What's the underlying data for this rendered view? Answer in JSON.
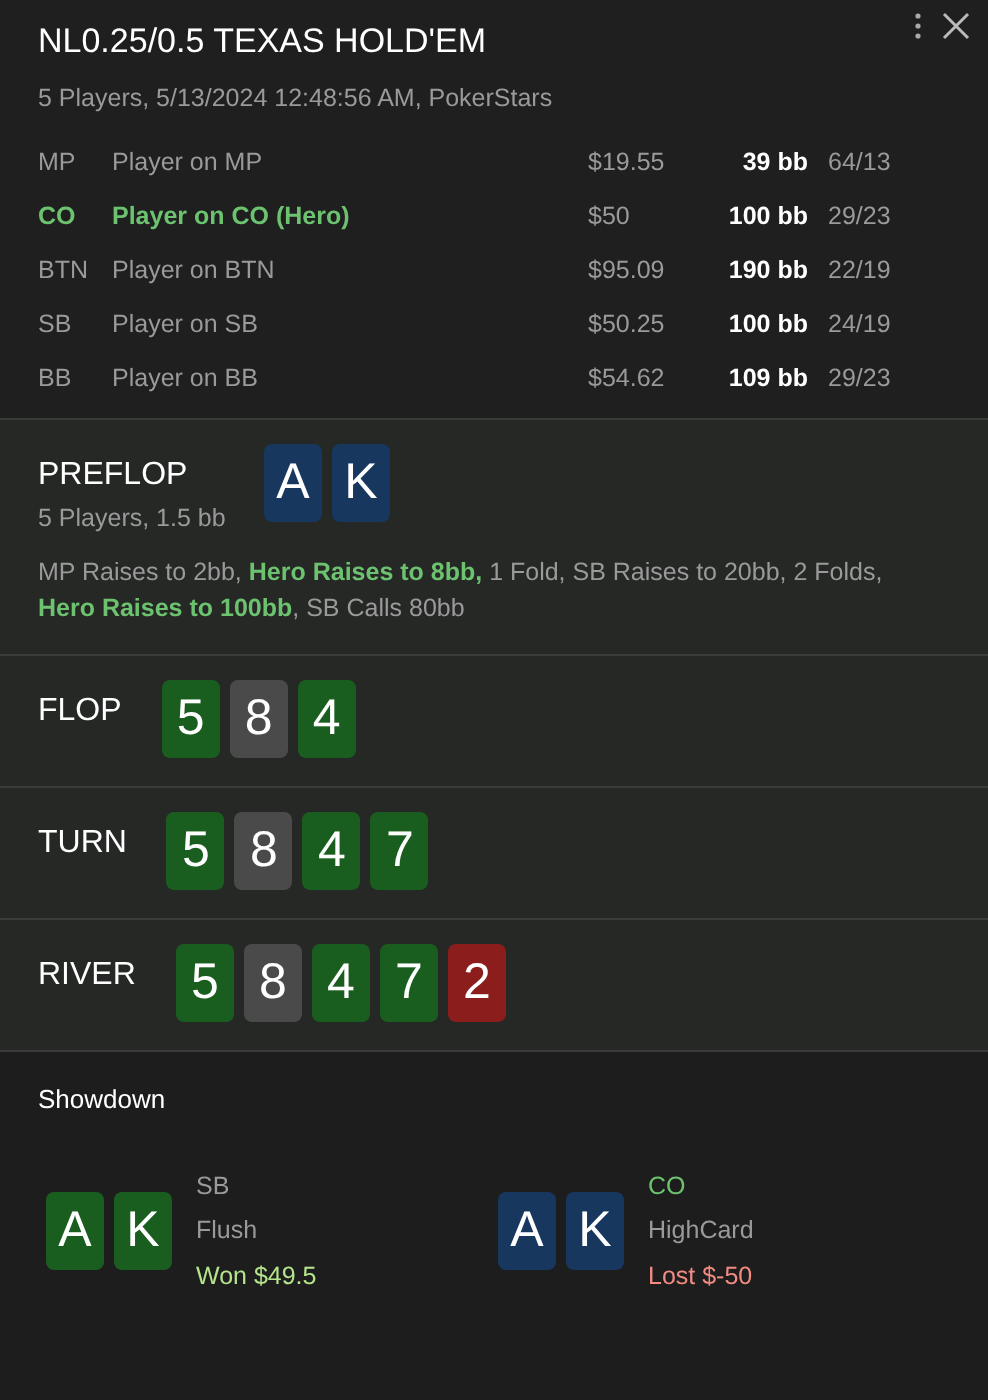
{
  "header": {
    "title": "NL0.25/0.5 TEXAS HOLD'EM",
    "subtitle": "5 Players, 5/13/2024 12:48:56 AM, PokerStars"
  },
  "players": [
    {
      "position": "MP",
      "name": "Player on MP",
      "stack": "$19.55",
      "bb": "39 bb",
      "stats": "64/13",
      "hero": false
    },
    {
      "position": "CO",
      "name": "Player on CO (Hero)",
      "stack": "$50",
      "bb": "100 bb",
      "stats": "29/23",
      "hero": true
    },
    {
      "position": "BTN",
      "name": "Player on BTN",
      "stack": "$95.09",
      "bb": "190 bb",
      "stats": "22/19",
      "hero": false
    },
    {
      "position": "SB",
      "name": "Player on SB",
      "stack": "$50.25",
      "bb": "100 bb",
      "stats": "24/19",
      "hero": false
    },
    {
      "position": "BB",
      "name": "Player on BB",
      "stack": "$54.62",
      "bb": "109 bb",
      "stats": "29/23",
      "hero": false
    }
  ],
  "streets": [
    {
      "name": "PREFLOP",
      "info": "5 Players, 1.5 bb",
      "cards": [
        {
          "rank": "A",
          "color": "#17375e"
        },
        {
          "rank": "K",
          "color": "#17375e"
        }
      ],
      "actions": "MP Raises to 2bb, **Hero Raises to 8bb,** 1 Fold, SB Raises to 20bb, 2 Folds, **Hero Raises to 100bb**, SB Calls 80bb"
    },
    {
      "name": "FLOP",
      "cards": [
        {
          "rank": "5",
          "color": "#1a5e1f"
        },
        {
          "rank": "8",
          "color": "#4a4a4a"
        },
        {
          "rank": "4",
          "color": "#1a5e1f"
        }
      ]
    },
    {
      "name": "TURN",
      "cards": [
        {
          "rank": "5",
          "color": "#1a5e1f"
        },
        {
          "rank": "8",
          "color": "#4a4a4a"
        },
        {
          "rank": "4",
          "color": "#1a5e1f"
        },
        {
          "rank": "7",
          "color": "#1a5e1f"
        }
      ]
    },
    {
      "name": "RIVER",
      "cards": [
        {
          "rank": "5",
          "color": "#1a5e1f"
        },
        {
          "rank": "8",
          "color": "#4a4a4a"
        },
        {
          "rank": "4",
          "color": "#1a5e1f"
        },
        {
          "rank": "7",
          "color": "#1a5e1f"
        },
        {
          "rank": "2",
          "color": "#8b1d1d"
        }
      ]
    }
  ],
  "showdown": {
    "title": "Showdown",
    "hands": [
      {
        "cards": [
          {
            "rank": "A",
            "color": "#1a5e1f"
          },
          {
            "rank": "K",
            "color": "#1a5e1f"
          }
        ],
        "position": "SB",
        "hero": false,
        "hand": "Flush",
        "result": "Won $49.5",
        "won": true
      },
      {
        "cards": [
          {
            "rank": "A",
            "color": "#17375e"
          },
          {
            "rank": "K",
            "color": "#17375e"
          }
        ],
        "position": "CO",
        "hero": true,
        "hand": "HighCard",
        "result": "Lost $-50",
        "won": false
      }
    ]
  }
}
